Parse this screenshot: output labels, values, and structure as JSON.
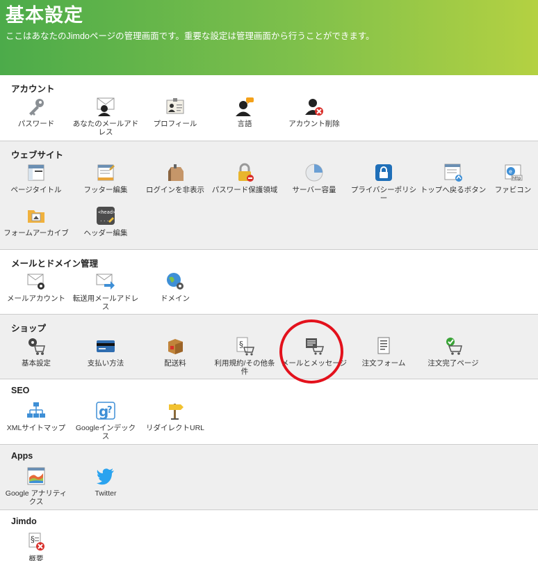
{
  "header": {
    "title": "基本設定",
    "subtitle": "ここはあなたのJimdoページの管理画面です。重要な設定は管理画面から行うことができます。"
  },
  "sections": [
    {
      "title": "アカウント",
      "items": [
        {
          "label": "パスワード",
          "icon": "key-icon"
        },
        {
          "label": "あなたのメールアドレス",
          "icon": "user-mail-icon"
        },
        {
          "label": "プロフィール",
          "icon": "profile-card-icon"
        },
        {
          "label": "言語",
          "icon": "user-speech-icon"
        },
        {
          "label": "アカウント削除",
          "icon": "user-delete-icon"
        }
      ]
    },
    {
      "title": "ウェブサイト",
      "items": [
        {
          "label": "ページタイトル",
          "icon": "page-title-icon"
        },
        {
          "label": "フッター編集",
          "icon": "footer-edit-icon"
        },
        {
          "label": "ログインを非表示",
          "icon": "login-hide-icon"
        },
        {
          "label": "パスワード保護領域",
          "icon": "lock-icon"
        },
        {
          "label": "サーバー容量",
          "icon": "pie-chart-icon"
        },
        {
          "label": "プライバシーポリシー",
          "icon": "privacy-lock-icon"
        },
        {
          "label": "トップへ戻るボタン",
          "icon": "back-to-top-icon"
        },
        {
          "label": "ファビコン",
          "icon": "favicon-icon"
        },
        {
          "label": "フォームアーカイブ",
          "icon": "folder-icon"
        },
        {
          "label": "ヘッダー編集",
          "icon": "head-code-icon"
        }
      ]
    },
    {
      "title": "メールとドメイン管理",
      "items": [
        {
          "label": "メールアカウント",
          "icon": "mail-gear-icon"
        },
        {
          "label": "転送用メールアドレス",
          "icon": "mail-forward-icon"
        },
        {
          "label": "ドメイン",
          "icon": "globe-gear-icon"
        }
      ]
    },
    {
      "title": "ショップ",
      "items": [
        {
          "label": "基本設定",
          "icon": "cart-gear-icon"
        },
        {
          "label": "支払い方法",
          "icon": "credit-card-icon"
        },
        {
          "label": "配送料",
          "icon": "box-icon"
        },
        {
          "label": "利用規約/その他条件",
          "icon": "cart-terms-icon"
        },
        {
          "label": "メールとメッセージ",
          "icon": "cart-message-icon"
        },
        {
          "label": "注文フォーム",
          "icon": "order-form-icon"
        },
        {
          "label": "注文完了ページ",
          "icon": "cart-check-icon"
        }
      ]
    },
    {
      "title": "SEO",
      "items": [
        {
          "label": "XMLサイトマップ",
          "icon": "sitemap-icon"
        },
        {
          "label": "Googleインデックス",
          "icon": "google-index-icon"
        },
        {
          "label": "リダイレクトURL",
          "icon": "signpost-icon"
        }
      ]
    },
    {
      "title": "Apps",
      "items": [
        {
          "label": "Google アナリティクス",
          "icon": "analytics-icon"
        },
        {
          "label": "Twitter",
          "icon": "twitter-bird-icon"
        }
      ]
    },
    {
      "title": "Jimdo",
      "items": [
        {
          "label": "概要",
          "icon": "terms-delete-icon"
        }
      ]
    }
  ],
  "colors": {
    "header_start": "#4cab4a",
    "header_end": "#b4d142",
    "highlight_circle": "#e3111c"
  }
}
